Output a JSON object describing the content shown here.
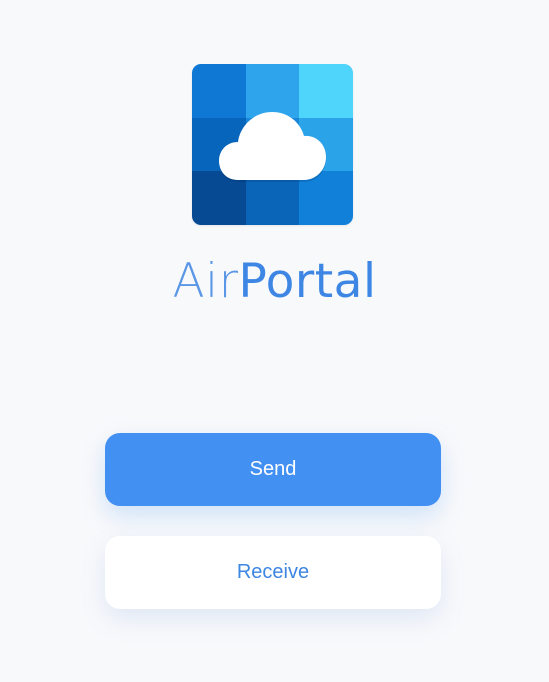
{
  "app": {
    "brand_part1": "Air",
    "brand_part2": "Portal"
  },
  "logo": {
    "icon": "cloud-icon",
    "tile_colors": [
      "#0f78d4",
      "#2ea4ec",
      "#4fd4fb",
      "#0865bc",
      "#1a86d8",
      "#2aa3e8",
      "#064a93",
      "#0a64b8",
      "#1180d9"
    ]
  },
  "actions": {
    "send_label": "Send",
    "receive_label": "Receive"
  },
  "colors": {
    "accent": "#4390f3",
    "background": "#f8f9fb"
  }
}
